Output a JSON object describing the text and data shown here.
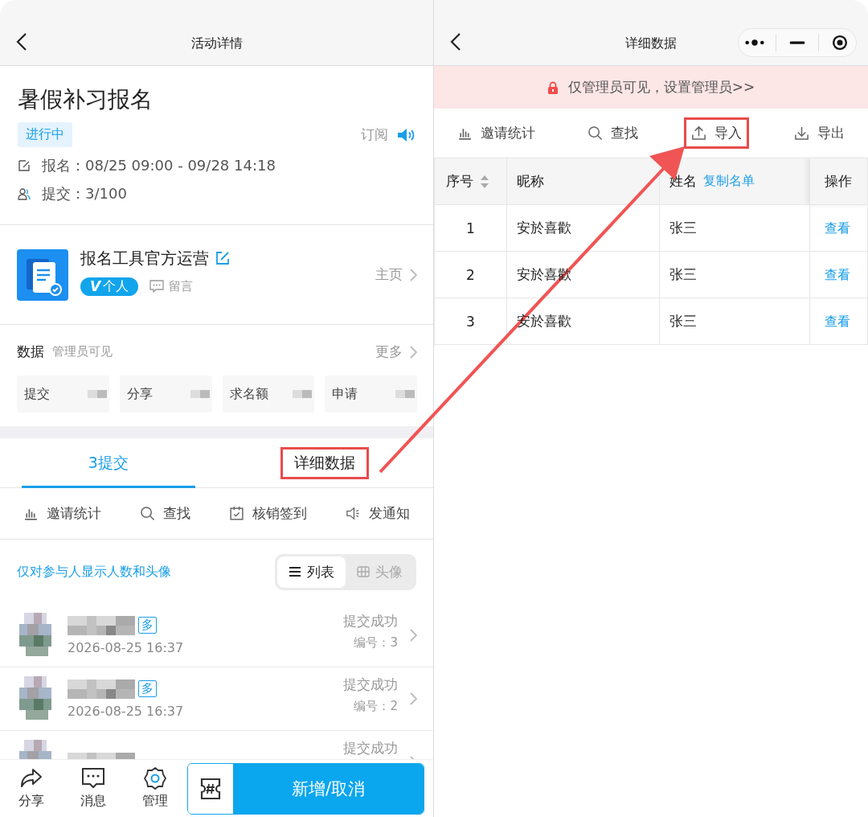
{
  "left_screen": {
    "nav": {
      "title": "活动详情"
    },
    "activity": {
      "title": "暑假补习报名",
      "status": "进行中",
      "subscribe": "订阅",
      "signup": "报名：08/25 09:00 - 09/28 14:18",
      "submitted": "提交：3/100"
    },
    "organizer": {
      "name": "报名工具官方运营",
      "badge_mark": "V",
      "badge": "个人",
      "message": "留言",
      "homepage": "主页"
    },
    "data": {
      "title": "数据",
      "note": "管理员可见",
      "more": "更多",
      "cards": [
        "提交",
        "分享",
        "求名额",
        "申请"
      ]
    },
    "tabs": [
      {
        "label": "3提交",
        "selected": true,
        "highlighted": false
      },
      {
        "label": "详细数据",
        "selected": false,
        "highlighted": true
      }
    ],
    "toolbar": [
      {
        "label": "邀请统计",
        "kind": "stats"
      },
      {
        "label": "查找",
        "kind": "search"
      },
      {
        "label": "核销签到",
        "kind": "checkin"
      },
      {
        "label": "发通知",
        "kind": "notify"
      }
    ],
    "privacy_link": "仅对参与人显示人数和头像",
    "view_toggle": [
      {
        "label": "列表",
        "kind": "list",
        "selected": true
      },
      {
        "label": "头像",
        "kind": "grid",
        "selected": false
      }
    ],
    "submissions": [
      {
        "tag": "多",
        "time": "2026-08-25 16:37",
        "status": "提交成功",
        "number": "编号：3"
      },
      {
        "tag": "多",
        "time": "2026-08-25 16:37",
        "status": "提交成功",
        "number": "编号：2"
      },
      {
        "status": "提交成功"
      }
    ],
    "bottom_bar": [
      {
        "label": "分享",
        "kind": "share"
      },
      {
        "label": "消息",
        "kind": "message"
      },
      {
        "label": "管理",
        "kind": "settings"
      }
    ],
    "main_action": "新增/取消"
  },
  "right_screen": {
    "nav": {
      "title": "详细数据"
    },
    "banner": "仅管理员可见，设置管理员>>",
    "toolbar": [
      {
        "label": "邀请统计",
        "kind": "stats",
        "highlighted": false
      },
      {
        "label": "查找",
        "kind": "search",
        "highlighted": false
      },
      {
        "label": "导入",
        "kind": "import",
        "highlighted": true
      },
      {
        "label": "导出",
        "kind": "export",
        "highlighted": false
      }
    ],
    "table": {
      "columns": [
        {
          "label": "序号",
          "sortable": true
        },
        {
          "label": "昵称"
        },
        {
          "label": "姓名",
          "action": "复制名单"
        },
        {
          "label": "操作"
        }
      ],
      "rows": [
        [
          "1",
          "安於喜歡",
          "张三",
          "查看"
        ],
        [
          "2",
          "安於喜歡",
          "张三",
          "查看"
        ],
        [
          "3",
          "安於喜歡",
          "张三",
          "查看"
        ]
      ]
    }
  }
}
